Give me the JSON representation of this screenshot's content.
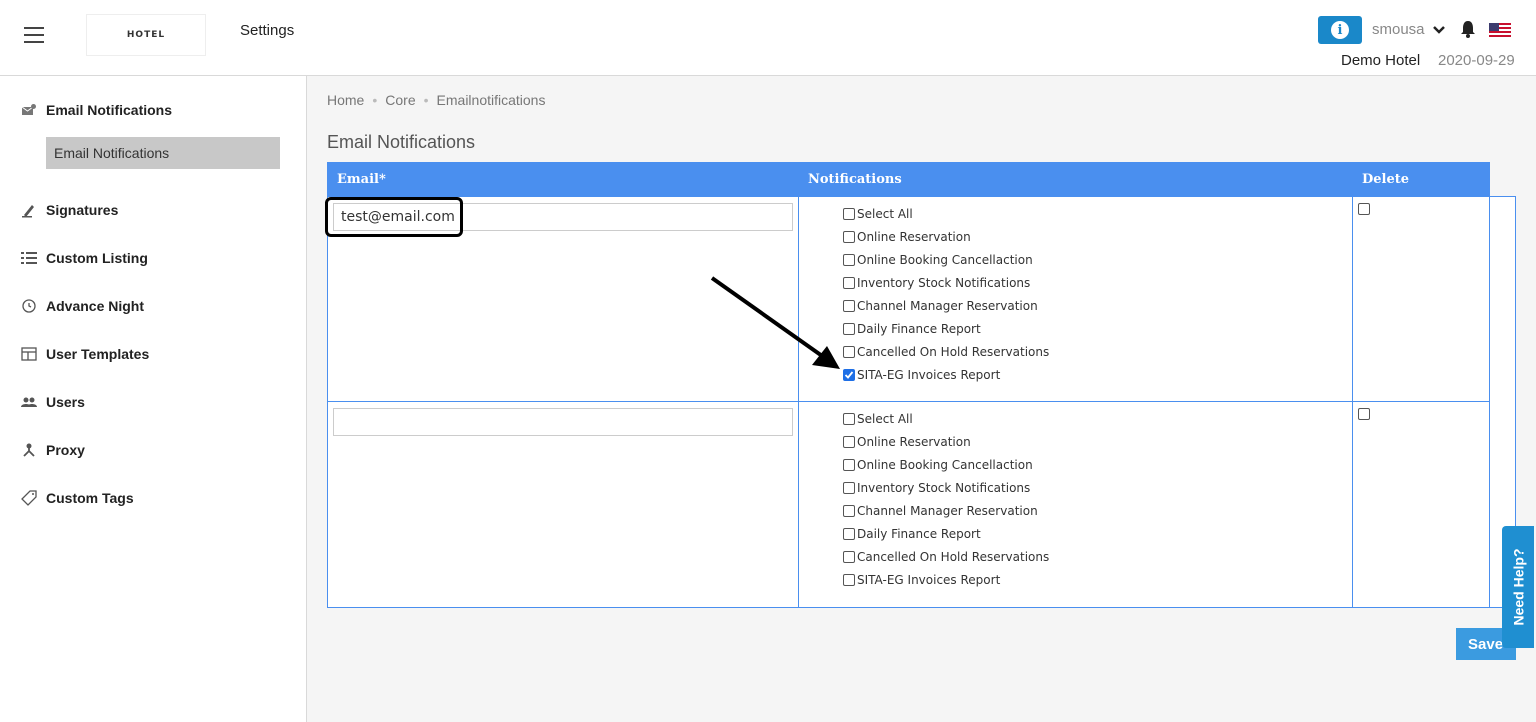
{
  "header": {
    "logo_text": "HOTEL",
    "title": "Settings",
    "user": "smousa",
    "hotel_name": "Demo Hotel",
    "date": "2020-09-29"
  },
  "sidebar": {
    "items": [
      {
        "label": "Email Notifications",
        "icon": "email-gear-icon"
      },
      {
        "label": "Signatures",
        "icon": "pen-icon"
      },
      {
        "label": "Custom Listing",
        "icon": "list-icon"
      },
      {
        "label": "Advance Night",
        "icon": "night-clock-icon"
      },
      {
        "label": "User Templates",
        "icon": "template-icon"
      },
      {
        "label": "Users",
        "icon": "users-icon"
      },
      {
        "label": "Proxy",
        "icon": "proxy-icon"
      },
      {
        "label": "Custom Tags",
        "icon": "tag-icon"
      }
    ],
    "sub_item": "Email Notifications"
  },
  "breadcrumb": [
    "Home",
    "Core",
    "Emailnotifications"
  ],
  "page_title": "Email Notifications",
  "table": {
    "headers": {
      "email": "Email*",
      "notifications": "Notifications",
      "delete": "Delete"
    },
    "options": [
      "Select All",
      "Online Reservation",
      "Online Booking Cancellaction",
      "Inventory Stock Notifications",
      "Channel Manager Reservation",
      "Daily Finance Report",
      "Cancelled On Hold Reservations",
      "SITA-EG Invoices Report"
    ],
    "rows": [
      {
        "email": "test@email.com",
        "checked": [
          "SITA-EG Invoices Report"
        ]
      },
      {
        "email": "",
        "checked": []
      }
    ]
  },
  "save_label": "Save",
  "help_label": "Need Help?",
  "colors": {
    "header_blue": "#4a8fef",
    "accent": "#1a88c9"
  }
}
